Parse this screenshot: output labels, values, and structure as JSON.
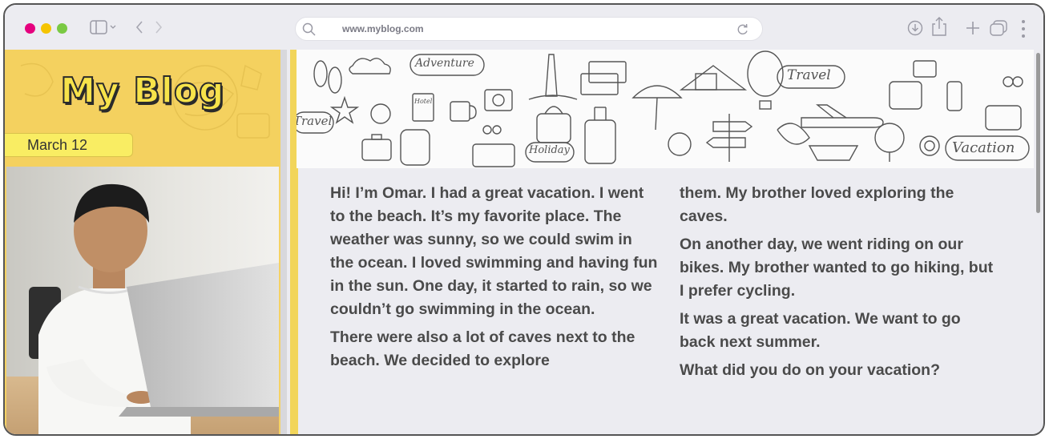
{
  "browser": {
    "traffic_lights": [
      "#e5007e",
      "#f5c400",
      "#7ac943"
    ],
    "url": "www.myblog.com",
    "icons": [
      "sidebar-icon",
      "chevron-down-icon",
      "back-icon",
      "forward-icon",
      "search-icon",
      "reload-icon",
      "download-icon",
      "share-icon",
      "new-tab-icon",
      "tabs-icon",
      "more-icon"
    ]
  },
  "sidebar": {
    "title": "My Blog",
    "date": "March 12"
  },
  "banner": {
    "words": [
      "Adventure",
      "Travel",
      "Travel",
      "Holiday",
      "Vacation",
      "Hotel"
    ]
  },
  "post": {
    "column1": [
      "Hi! I’m Omar. I had a great vacation. I went to the beach. It’s my favorite place. The weather was sunny, so we could swim in the ocean. I loved swimming and having fun in the sun. One day, it started to rain, so we couldn’t go swimming in the ocean.",
      "There were also a lot of caves next to the beach. We decided to explore"
    ],
    "column2": [
      "them. My brother loved exploring the caves.",
      "On another day, we went riding on our bikes. My brother wanted to go hiking, but I prefer cycling.",
      "It was a great vacation. We want to go back next summer.",
      "What did you do on your vacation?"
    ]
  },
  "colors": {
    "accent_yellow": "#f5d264",
    "title_fill": "#f7e34a",
    "text": "#4a4a4a"
  }
}
